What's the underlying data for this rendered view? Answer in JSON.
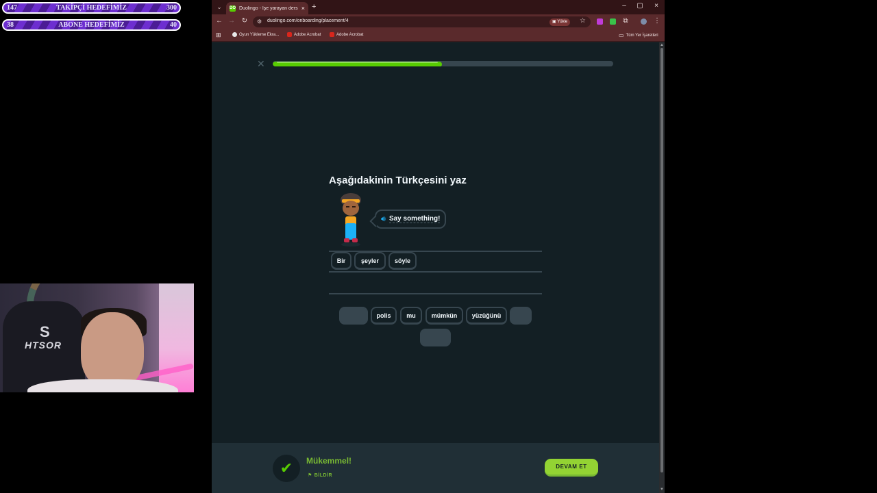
{
  "overlay": {
    "followers_goal": {
      "current": "147",
      "label": "TAKİPÇİ HEDEFİMİZ",
      "target": "300"
    },
    "subs_goal": {
      "current": "38",
      "label": "ABONE HEDEFİMİZ",
      "target": "40"
    }
  },
  "webcam": {
    "chair_logo": "HTSOR",
    "chair_emblem": "S"
  },
  "browser": {
    "tab": {
      "favicon": "DO",
      "title": "Duolingo - İşe yarayan derslerle...",
      "close": "×"
    },
    "new_tab": "+",
    "window_controls": [
      "–",
      "▢",
      "×"
    ],
    "url": "duolingo.com/onboarding/placement/4",
    "install_label": "Yükle",
    "bookmarks": [
      {
        "label": "Oyun Yükleme Ekra...",
        "color": "#222222"
      },
      {
        "label": "Adobe Acrobat",
        "color": "#d9261c"
      },
      {
        "label": "Adobe Acrobat",
        "color": "#d9261c"
      }
    ],
    "all_bookmarks": "Tüm Yer İşaretleri"
  },
  "lesson": {
    "progress_percent": 49.7,
    "prompt": "Aşağıdakinin Türkçesini yaz",
    "speech": "Say something!",
    "answer_words": [
      "Bir",
      "şeyler",
      "söyle"
    ],
    "bank_words": [
      "",
      "polis",
      "mu",
      "mümkün",
      "yüzüğünü",
      "",
      ""
    ],
    "feedback": "Mükemmel!",
    "report_label": "BİLDİR",
    "continue_label": "DEVAM ET"
  },
  "colors": {
    "brand_green": "#58cc02",
    "page_bg": "#131f24",
    "tab_bar": "#311416",
    "toolbar": "#5a2a2c"
  }
}
